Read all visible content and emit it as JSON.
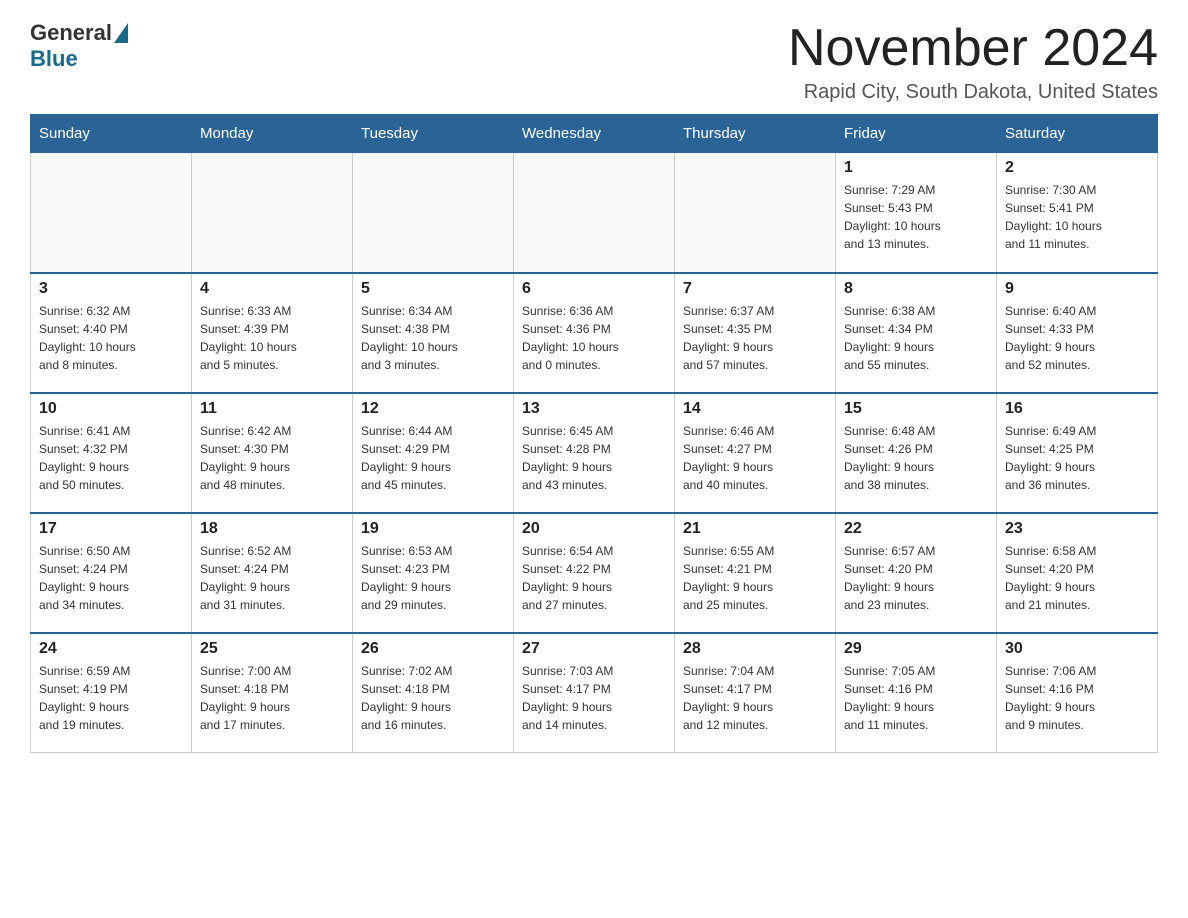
{
  "logo": {
    "general": "General",
    "blue": "Blue"
  },
  "header": {
    "month_year": "November 2024",
    "location": "Rapid City, South Dakota, United States"
  },
  "weekdays": [
    "Sunday",
    "Monday",
    "Tuesday",
    "Wednesday",
    "Thursday",
    "Friday",
    "Saturday"
  ],
  "rows": [
    [
      {
        "day": "",
        "info": ""
      },
      {
        "day": "",
        "info": ""
      },
      {
        "day": "",
        "info": ""
      },
      {
        "day": "",
        "info": ""
      },
      {
        "day": "",
        "info": ""
      },
      {
        "day": "1",
        "info": "Sunrise: 7:29 AM\nSunset: 5:43 PM\nDaylight: 10 hours\nand 13 minutes."
      },
      {
        "day": "2",
        "info": "Sunrise: 7:30 AM\nSunset: 5:41 PM\nDaylight: 10 hours\nand 11 minutes."
      }
    ],
    [
      {
        "day": "3",
        "info": "Sunrise: 6:32 AM\nSunset: 4:40 PM\nDaylight: 10 hours\nand 8 minutes."
      },
      {
        "day": "4",
        "info": "Sunrise: 6:33 AM\nSunset: 4:39 PM\nDaylight: 10 hours\nand 5 minutes."
      },
      {
        "day": "5",
        "info": "Sunrise: 6:34 AM\nSunset: 4:38 PM\nDaylight: 10 hours\nand 3 minutes."
      },
      {
        "day": "6",
        "info": "Sunrise: 6:36 AM\nSunset: 4:36 PM\nDaylight: 10 hours\nand 0 minutes."
      },
      {
        "day": "7",
        "info": "Sunrise: 6:37 AM\nSunset: 4:35 PM\nDaylight: 9 hours\nand 57 minutes."
      },
      {
        "day": "8",
        "info": "Sunrise: 6:38 AM\nSunset: 4:34 PM\nDaylight: 9 hours\nand 55 minutes."
      },
      {
        "day": "9",
        "info": "Sunrise: 6:40 AM\nSunset: 4:33 PM\nDaylight: 9 hours\nand 52 minutes."
      }
    ],
    [
      {
        "day": "10",
        "info": "Sunrise: 6:41 AM\nSunset: 4:32 PM\nDaylight: 9 hours\nand 50 minutes."
      },
      {
        "day": "11",
        "info": "Sunrise: 6:42 AM\nSunset: 4:30 PM\nDaylight: 9 hours\nand 48 minutes."
      },
      {
        "day": "12",
        "info": "Sunrise: 6:44 AM\nSunset: 4:29 PM\nDaylight: 9 hours\nand 45 minutes."
      },
      {
        "day": "13",
        "info": "Sunrise: 6:45 AM\nSunset: 4:28 PM\nDaylight: 9 hours\nand 43 minutes."
      },
      {
        "day": "14",
        "info": "Sunrise: 6:46 AM\nSunset: 4:27 PM\nDaylight: 9 hours\nand 40 minutes."
      },
      {
        "day": "15",
        "info": "Sunrise: 6:48 AM\nSunset: 4:26 PM\nDaylight: 9 hours\nand 38 minutes."
      },
      {
        "day": "16",
        "info": "Sunrise: 6:49 AM\nSunset: 4:25 PM\nDaylight: 9 hours\nand 36 minutes."
      }
    ],
    [
      {
        "day": "17",
        "info": "Sunrise: 6:50 AM\nSunset: 4:24 PM\nDaylight: 9 hours\nand 34 minutes."
      },
      {
        "day": "18",
        "info": "Sunrise: 6:52 AM\nSunset: 4:24 PM\nDaylight: 9 hours\nand 31 minutes."
      },
      {
        "day": "19",
        "info": "Sunrise: 6:53 AM\nSunset: 4:23 PM\nDaylight: 9 hours\nand 29 minutes."
      },
      {
        "day": "20",
        "info": "Sunrise: 6:54 AM\nSunset: 4:22 PM\nDaylight: 9 hours\nand 27 minutes."
      },
      {
        "day": "21",
        "info": "Sunrise: 6:55 AM\nSunset: 4:21 PM\nDaylight: 9 hours\nand 25 minutes."
      },
      {
        "day": "22",
        "info": "Sunrise: 6:57 AM\nSunset: 4:20 PM\nDaylight: 9 hours\nand 23 minutes."
      },
      {
        "day": "23",
        "info": "Sunrise: 6:58 AM\nSunset: 4:20 PM\nDaylight: 9 hours\nand 21 minutes."
      }
    ],
    [
      {
        "day": "24",
        "info": "Sunrise: 6:59 AM\nSunset: 4:19 PM\nDaylight: 9 hours\nand 19 minutes."
      },
      {
        "day": "25",
        "info": "Sunrise: 7:00 AM\nSunset: 4:18 PM\nDaylight: 9 hours\nand 17 minutes."
      },
      {
        "day": "26",
        "info": "Sunrise: 7:02 AM\nSunset: 4:18 PM\nDaylight: 9 hours\nand 16 minutes."
      },
      {
        "day": "27",
        "info": "Sunrise: 7:03 AM\nSunset: 4:17 PM\nDaylight: 9 hours\nand 14 minutes."
      },
      {
        "day": "28",
        "info": "Sunrise: 7:04 AM\nSunset: 4:17 PM\nDaylight: 9 hours\nand 12 minutes."
      },
      {
        "day": "29",
        "info": "Sunrise: 7:05 AM\nSunset: 4:16 PM\nDaylight: 9 hours\nand 11 minutes."
      },
      {
        "day": "30",
        "info": "Sunrise: 7:06 AM\nSunset: 4:16 PM\nDaylight: 9 hours\nand 9 minutes."
      }
    ]
  ]
}
